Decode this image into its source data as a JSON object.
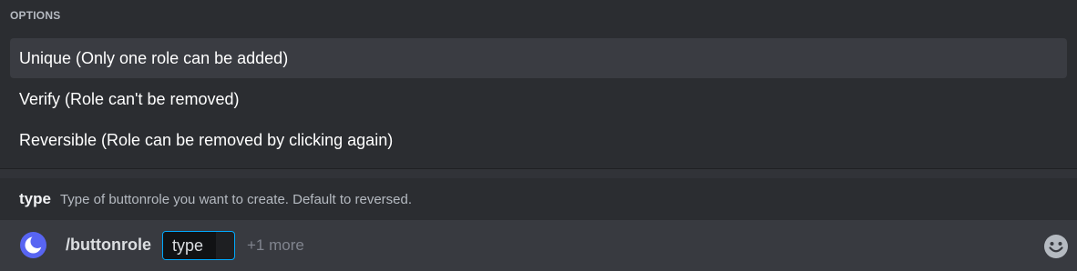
{
  "options": {
    "header": "OPTIONS",
    "items": [
      {
        "label": "Unique (Only one role can be added)",
        "selected": true
      },
      {
        "label": "Verify (Role can't be removed)",
        "selected": false
      },
      {
        "label": "Reversible (Role can be removed by clicking again)",
        "selected": false
      }
    ]
  },
  "hint": {
    "param_name": "type",
    "description": "Type of buttonrole you want to create. Default to reversed."
  },
  "chat_bar": {
    "avatar_icon": "moon-bot-avatar-icon",
    "command": "/buttonrole",
    "active_option": "type",
    "more": "+1 more",
    "emoji_icon": "smiley-emoji-icon"
  },
  "colors": {
    "background": "#313338",
    "panel": "#2b2d31",
    "selected_option": "#3a3c42",
    "input_bar": "#383a40",
    "accent_focus": "#00a8fc",
    "avatar_bg": "#5865f2"
  }
}
